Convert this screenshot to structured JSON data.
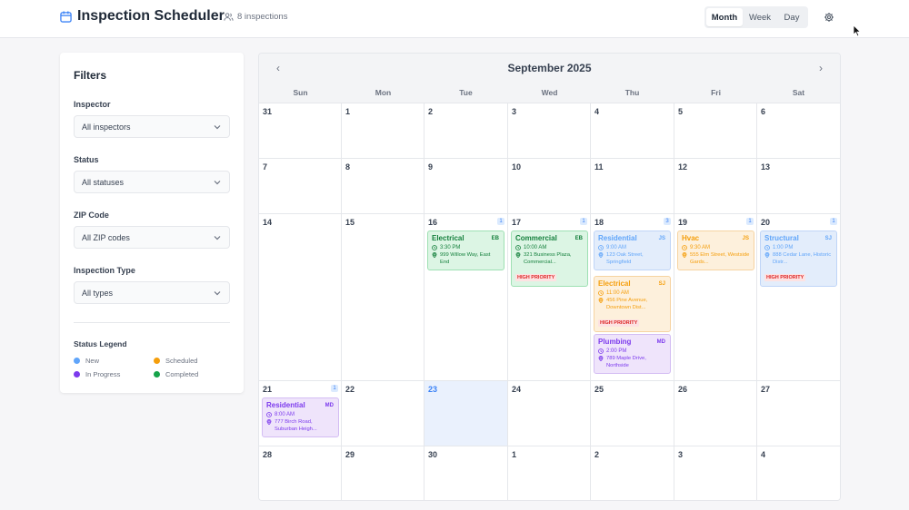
{
  "header": {
    "title": "Inspection Scheduler",
    "inspection_count": "8 inspections",
    "views": [
      "Month",
      "Week",
      "Day"
    ],
    "active_view": "Month",
    "icons": [
      "calendar-icon",
      "users-icon",
      "gear-icon"
    ]
  },
  "filters": {
    "title": "Filters",
    "inspector": {
      "label": "Inspector",
      "value": "All inspectors"
    },
    "status": {
      "label": "Status",
      "value": "All statuses"
    },
    "zip": {
      "label": "ZIP Code",
      "value": "All ZIP codes"
    },
    "type": {
      "label": "Inspection Type",
      "value": "All types"
    },
    "legend": {
      "title": "Status Legend",
      "items": [
        {
          "label": "New",
          "color": "#60a5fa"
        },
        {
          "label": "Scheduled",
          "color": "#f59e0b"
        },
        {
          "label": "In Progress",
          "color": "#7c3aed"
        },
        {
          "label": "Completed",
          "color": "#16a34a"
        }
      ]
    }
  },
  "calendar": {
    "month_title": "September 2025",
    "prev": "‹",
    "next": "›",
    "weekdays": [
      "Sun",
      "Mon",
      "Tue",
      "Wed",
      "Thu",
      "Fri",
      "Sat"
    ],
    "weeks": [
      [
        "31",
        "1",
        "2",
        "3",
        "4",
        "5",
        "6"
      ],
      [
        "7",
        "8",
        "9",
        "10",
        "11",
        "12",
        "13"
      ],
      [
        "14",
        "15",
        "16",
        "17",
        "18",
        "19",
        "20"
      ],
      [
        "21",
        "22",
        "23",
        "24",
        "25",
        "26",
        "27"
      ],
      [
        "28",
        "29",
        "30",
        "1",
        "2",
        "3",
        "4"
      ]
    ],
    "today": "23",
    "counts": {
      "d16": "1",
      "d17": "1",
      "d18": "3",
      "d19": "1",
      "d20": "1",
      "d21": "1"
    },
    "events": {
      "e16": {
        "type": "Electrical",
        "initials": "EB",
        "time": "3:30 PM",
        "address": "999 Willow Way, East End",
        "priority": ""
      },
      "e17": {
        "type": "Commercial",
        "initials": "EB",
        "time": "10:00 AM",
        "address": "321 Business Plaza, Commercial...",
        "priority": "HIGH PRIORITY"
      },
      "e18a": {
        "type": "Residential",
        "initials": "JS",
        "time": "9:00 AM",
        "address": "123 Oak Street, Springfield",
        "priority": ""
      },
      "e18b": {
        "type": "Electrical",
        "initials": "SJ",
        "time": "11:00 AM",
        "address": "456 Pine Avenue, Downtown Dist...",
        "priority": "HIGH PRIORITY"
      },
      "e18c": {
        "type": "Plumbing",
        "initials": "MD",
        "time": "2:00 PM",
        "address": "789 Maple Drive, Northside",
        "priority": ""
      },
      "e19": {
        "type": "Hvac",
        "initials": "JS",
        "time": "9:30 AM",
        "address": "555 Elm Street, Westside Gards...",
        "priority": ""
      },
      "e20": {
        "type": "Structural",
        "initials": "SJ",
        "time": "1:00 PM",
        "address": "888 Cedar Lane, Historic Distr...",
        "priority": "HIGH PRIORITY"
      },
      "e21": {
        "type": "Residential",
        "initials": "MD",
        "time": "8:00 AM",
        "address": "777 Birch Road, Suburban Heigh...",
        "priority": ""
      }
    }
  }
}
